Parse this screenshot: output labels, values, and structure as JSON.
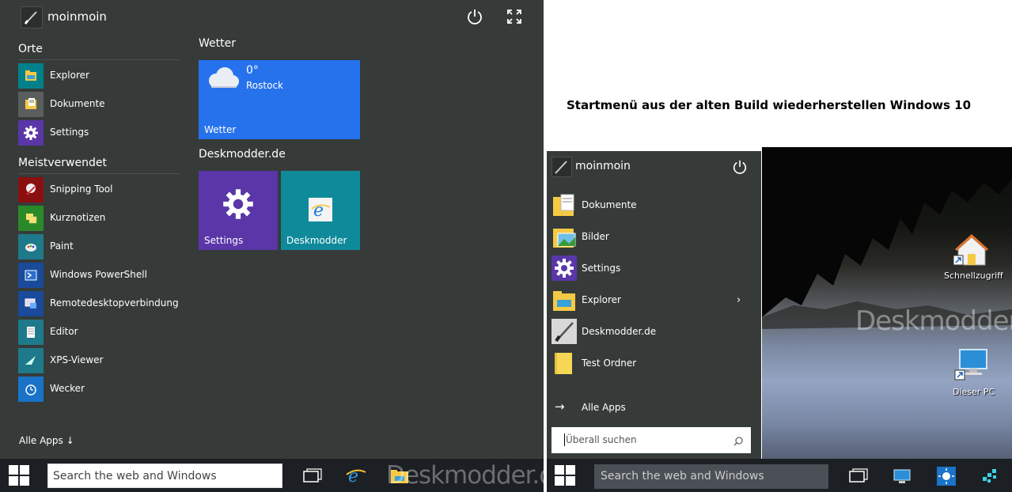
{
  "left_menu": {
    "username": "moinmoin",
    "sections": {
      "orte": "Orte",
      "meistverwendet": "Meistverwendet"
    },
    "orte_items": [
      {
        "label": "Explorer",
        "icon": "explorer-icon",
        "color": "#00808a"
      },
      {
        "label": "Dokumente",
        "icon": "documents-icon",
        "color": "#5a5f5d"
      },
      {
        "label": "Settings",
        "icon": "gear-icon",
        "color": "#5a36a8"
      }
    ],
    "frequent_items": [
      {
        "label": "Snipping Tool",
        "icon": "snipping-tool-icon",
        "color": "#8a1010"
      },
      {
        "label": "Kurznotizen",
        "icon": "sticky-notes-icon",
        "color": "#2a8a2a"
      },
      {
        "label": "Paint",
        "icon": "paint-icon",
        "color": "#1e7a8a"
      },
      {
        "label": "Windows PowerShell",
        "icon": "powershell-icon",
        "color": "#1a4a9a"
      },
      {
        "label": "Remotedesktopverbindung",
        "icon": "remote-desktop-icon",
        "color": "#1a4a9a"
      },
      {
        "label": "Editor",
        "icon": "notepad-icon",
        "color": "#1e7a8a"
      },
      {
        "label": "XPS-Viewer",
        "icon": "xps-viewer-icon",
        "color": "#1e7a8a"
      },
      {
        "label": "Wecker",
        "icon": "alarm-icon",
        "color": "#1a73c8"
      }
    ],
    "all_apps": "Alle Apps ↓",
    "groups": {
      "weather_title": "Wetter",
      "deskmodder_title": "Deskmodder.de"
    },
    "weather_tile": {
      "temp": "0°",
      "city": "Rostock",
      "label": "Wetter",
      "color": "#2672ec"
    },
    "settings_tile": {
      "label": "Settings",
      "color": "#5a36a8"
    },
    "deskmodder_tile": {
      "label": "Deskmodder",
      "color": "#0f8a9a"
    }
  },
  "taskbar_left": {
    "search_placeholder": "Search the web and Windows",
    "watermark": "Deskmodder.de"
  },
  "right": {
    "title": "Startmenü aus der alten Build wiederherstellen Windows 10",
    "username": "moinmoin",
    "items": [
      {
        "label": "Dokumente",
        "icon": "documents-folder-icon"
      },
      {
        "label": "Bilder",
        "icon": "pictures-folder-icon"
      },
      {
        "label": "Settings",
        "icon": "gear-icon"
      },
      {
        "label": "Explorer",
        "icon": "explorer-folder-icon"
      },
      {
        "label": "Deskmodder.de",
        "icon": "deskmodder-icon"
      },
      {
        "label": "Test Ordner",
        "icon": "folder-icon"
      }
    ],
    "all_apps": "Alle Apps",
    "search_placeholder": "Überall suchen",
    "desktop_icons": {
      "quick_access": "Schnellzugriff",
      "this_pc": "Dieser PC"
    },
    "watermark": "Deskmodder.de",
    "taskbar_search": "Search the web and Windows"
  }
}
